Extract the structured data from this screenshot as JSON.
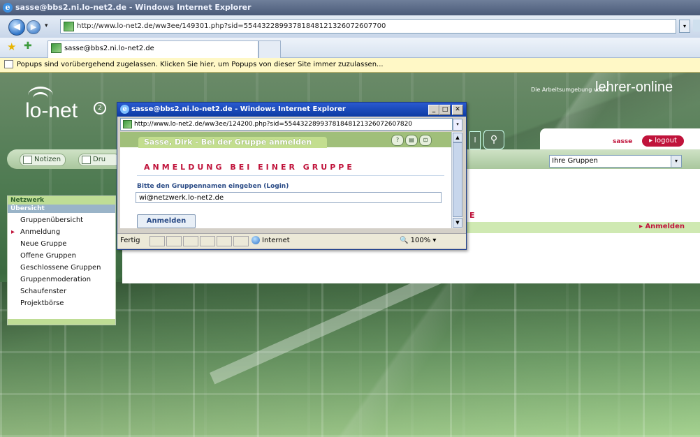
{
  "outer_window": {
    "title": "sasse@bbs2.ni.lo-net2.de - Windows Internet Explorer",
    "address": "http://www.lo-net2.de/ww3ee/149301.php?sid=554432289937818481213260726077​00",
    "tab_title": "sasse@bbs2.ni.lo-net2.de",
    "popup_info": "Popups sind vorübergehend zugelassen. Klicken Sie hier, um Popups von dieser Site immer zuzulassen..."
  },
  "page": {
    "logo_text": "lo-net",
    "logo_badge": "2",
    "tagline": "Die Arbeitsumgebung von ▸",
    "brand": "lehrer-online",
    "user_name": "sasse",
    "logout_label": "▸ logout",
    "toolbar": {
      "notizen": "Notizen",
      "druck": "Dru"
    },
    "groups_select_value": "Ihre Gruppen",
    "header_fragment": "E",
    "anmelden_link": "▸ Anmelden"
  },
  "sidebar": {
    "heading": "Netzwerk",
    "subheading": "Übersicht",
    "items": [
      {
        "label": "Gruppenübersicht"
      },
      {
        "label": "Anmeldung"
      },
      {
        "label": "Neue Gruppe"
      },
      {
        "label": "Offene Gruppen"
      },
      {
        "label": "Geschlossene Gruppen"
      },
      {
        "label": "Gruppenmoderation"
      },
      {
        "label": "Schaufenster"
      },
      {
        "label": "Projektbörse"
      }
    ]
  },
  "popup": {
    "title": "sasse@bbs2.ni.lo-net2.de - Windows Internet Explorer",
    "address": "http://www.lo-net2.de/ww3ee/124200.php?sid=554432289937818481213260726078​20",
    "header_tab": "Sasse, Dirk - Bei der Gruppe anmelden",
    "heading": "ANMELDUNG BEI EINER GRUPPE",
    "field_label": "Bitte den Gruppennamen eingeben (Login)",
    "field_value": "wi@netzwerk.lo-net2.de",
    "submit_label": "Anmelden",
    "status": {
      "text": "Fertig",
      "zone": "Internet",
      "zoom": "100%"
    }
  },
  "colors": {
    "accent_red": "#c0133b",
    "ie_title_blue": "#0c3ba3",
    "lo_green": "#a0bf7a"
  }
}
